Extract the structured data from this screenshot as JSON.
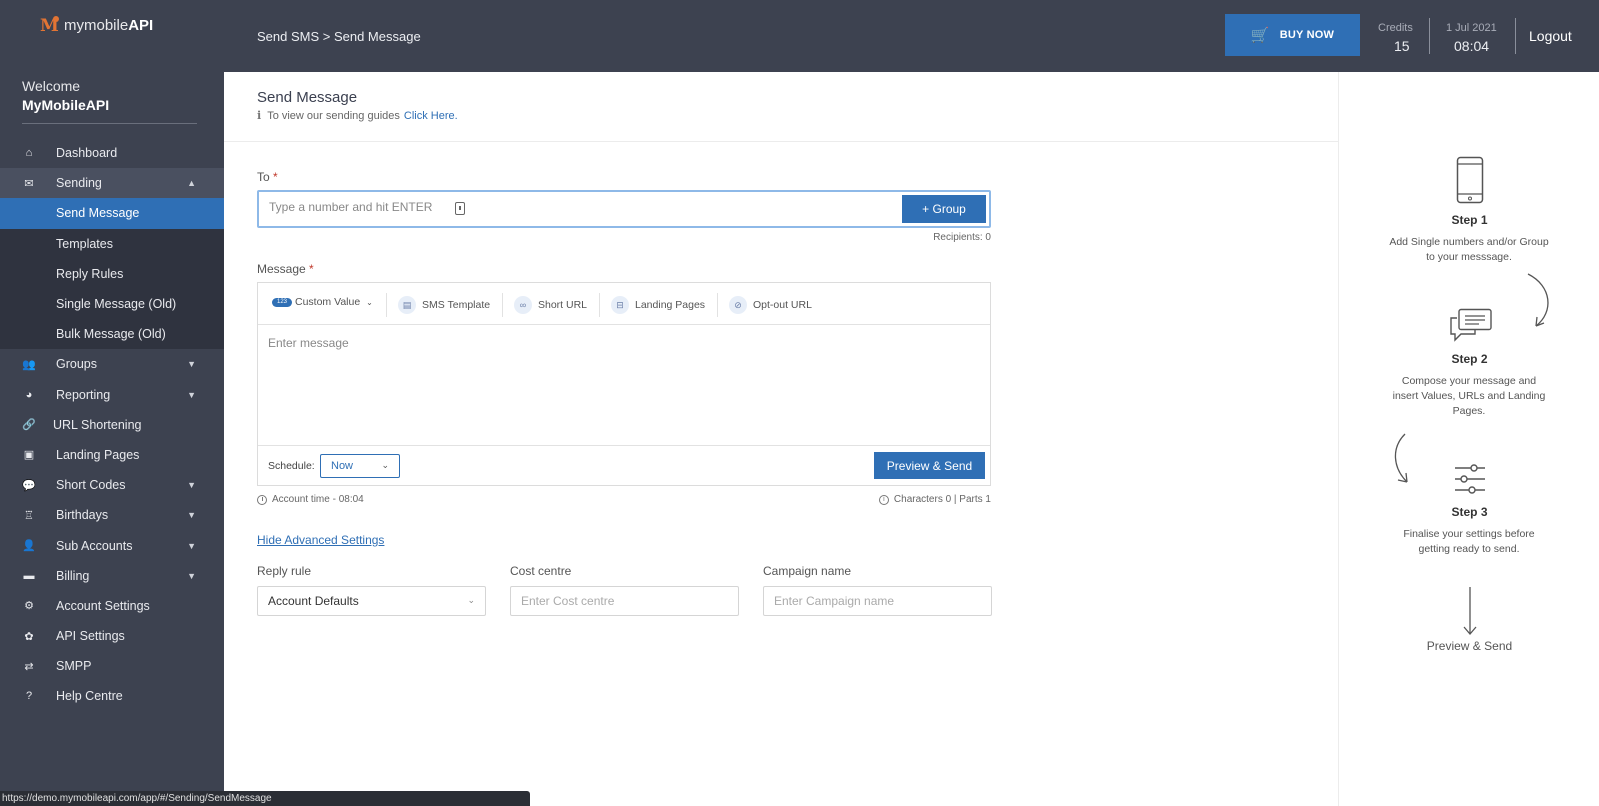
{
  "app": {
    "logo_text": "mymobile",
    "logo_bold": "API"
  },
  "sidebar": {
    "welcome": "Welcome",
    "user": "MyMobileAPI",
    "items": [
      {
        "label": "Dashboard",
        "icon": "home-icon"
      },
      {
        "label": "Sending",
        "icon": "envelope-icon",
        "expanded": true,
        "children": [
          {
            "label": "Send Message",
            "active": true
          },
          {
            "label": "Templates"
          },
          {
            "label": "Reply Rules"
          },
          {
            "label": "Single Message (Old)"
          },
          {
            "label": "Bulk Message (Old)"
          }
        ]
      },
      {
        "label": "Groups",
        "icon": "users-icon",
        "has_children": true
      },
      {
        "label": "Reporting",
        "icon": "chart-icon",
        "has_children": true
      },
      {
        "label": "URL Shortening",
        "icon": "link-icon"
      },
      {
        "label": "Landing Pages",
        "icon": "window-icon"
      },
      {
        "label": "Short Codes",
        "icon": "chat-icon",
        "has_children": true
      },
      {
        "label": "Birthdays",
        "icon": "cake-icon",
        "has_children": true
      },
      {
        "label": "Sub Accounts",
        "icon": "user-plus-icon",
        "has_children": true
      },
      {
        "label": "Billing",
        "icon": "credit-card-icon",
        "has_children": true
      },
      {
        "label": "Account Settings",
        "icon": "gears-icon"
      },
      {
        "label": "API Settings",
        "icon": "api-icon"
      },
      {
        "label": "SMPP",
        "icon": "arrows-icon"
      },
      {
        "label": "Help Centre",
        "icon": "question-icon"
      }
    ]
  },
  "header": {
    "breadcrumb": "Send SMS > Send Message",
    "buy_now": "BUY NOW",
    "credits_label": "Credits",
    "credits_value": "15",
    "date": "1 Jul 2021",
    "time": "08:04",
    "logout": "Logout"
  },
  "main": {
    "title": "Send Message",
    "guide_text": "To view our sending guides",
    "guide_link": "Click Here.",
    "to_label": "To",
    "to_placeholder": "Type a number and hit ENTER",
    "group_button": "+ Group",
    "recipients": "Recipients: 0",
    "message_label": "Message",
    "toolbar": {
      "custom_value_badge": "123",
      "custom_value": "Custom Value",
      "sms_template": "SMS Template",
      "short_url": "Short URL",
      "landing_pages": "Landing Pages",
      "opt_out_url": "Opt-out URL"
    },
    "message_placeholder": "Enter message",
    "schedule_label": "Schedule:",
    "schedule_value": "Now",
    "preview_send": "Preview & Send",
    "account_time": "Account time - 08:04",
    "characters": "Characters 0 | Parts 1",
    "hide_advanced": "Hide Advanced Settings",
    "reply_rule_label": "Reply rule",
    "reply_rule_value": "Account Defaults",
    "cost_centre_label": "Cost centre",
    "cost_centre_placeholder": "Enter Cost centre",
    "campaign_label": "Campaign name",
    "campaign_placeholder": "Enter Campaign name"
  },
  "steps": [
    {
      "title": "Step 1",
      "desc": "Add Single numbers and/or Group to your messsage."
    },
    {
      "title": "Step 2",
      "desc": "Compose your message and insert Values, URLs and Landing Pages."
    },
    {
      "title": "Step 3",
      "desc": "Finalise your settings before getting ready to send."
    }
  ],
  "final_step": "Preview & Send",
  "status_url": "https://demo.mymobileapi.com/app/#/Sending/SendMessage",
  "colors": {
    "sidebar_bg": "#3d4250",
    "accent": "#2f6fb5",
    "submenu_bg": "#2f333f"
  }
}
